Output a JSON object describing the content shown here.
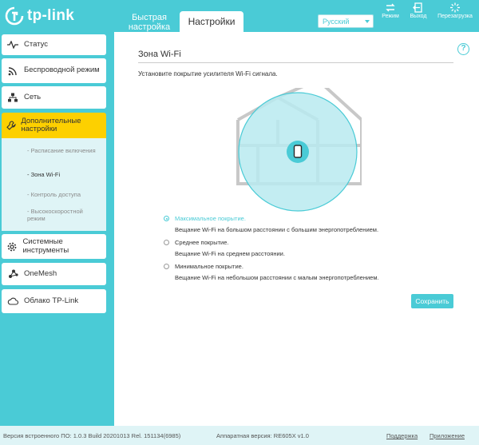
{
  "brand": {
    "logo_text": "tp-link",
    "accent": "#4acbd6",
    "highlight": "#fdd000"
  },
  "header": {
    "tabs": [
      {
        "label": "Быстрая настройка",
        "icon": "none"
      },
      {
        "label": "Настройки",
        "icon": "none"
      }
    ],
    "language": "Русский",
    "buttons": [
      {
        "label": "Режим",
        "icon": "mode-icon"
      },
      {
        "label": "Выход",
        "icon": "logout-icon"
      },
      {
        "label": "Перезагрузка",
        "icon": "reboot-icon"
      }
    ]
  },
  "sidebar": {
    "items": [
      {
        "label": "Статус",
        "icon": "status-icon"
      },
      {
        "label": "Беспроводной режим",
        "icon": "wireless-icon"
      },
      {
        "label": "Сеть",
        "icon": "network-icon"
      },
      {
        "label": "Дополнительные настройки",
        "icon": "advanced-icon"
      },
      {
        "label": "Системные инструменты",
        "icon": "system-tools-icon"
      },
      {
        "label": "OneMesh",
        "icon": "onemesh-icon"
      },
      {
        "label": "Облако TP-Link",
        "icon": "cloud-icon"
      }
    ],
    "subitems": [
      {
        "label": "- Расписание включения"
      },
      {
        "label": "- Зона Wi-Fi"
      },
      {
        "label": "- Контроль доступа"
      },
      {
        "label": "- Высокоскоростной режим"
      }
    ]
  },
  "main": {
    "title": "Зона Wi-Fi",
    "description": "Установите покрытие усилителя Wi-Fi сигнала.",
    "options": [
      {
        "label": "Максимальное покрытие.",
        "description": "Вещание Wi-Fi на большом расстоянии с большим энергопотреблением.",
        "selected": true
      },
      {
        "label": "Среднее покрытие.",
        "description": "Вещание Wi-Fi на среднем расстоянии.",
        "selected": false
      },
      {
        "label": "Минимальное покрытие.",
        "description": "Вещание Wi-Fi на небольшом расстоянии с малым энергопотреблением.",
        "selected": false
      }
    ],
    "save_label": "Сохранить",
    "help": "?"
  },
  "footer": {
    "firmware": "Версия встроенного ПО: 1.0.3 Build 20201013 Rel. 151134(6985)",
    "hardware": "Аппаратная версия: RE605X v1.0",
    "support": "Поддержка",
    "app": "Приложение"
  }
}
